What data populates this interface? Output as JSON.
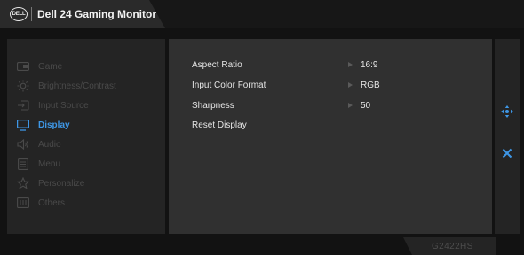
{
  "header": {
    "logo_text": "DELL",
    "title": "Dell 24 Gaming Monitor"
  },
  "colors": {
    "accent": "#3e97e6",
    "inactive_text": "#4a4a4a",
    "content_bg": "#303030",
    "panel_bg": "#242424"
  },
  "sidebar": {
    "items": [
      {
        "label": "Game",
        "icon": "game-icon",
        "active": false
      },
      {
        "label": "Brightness/Contrast",
        "icon": "brightness-icon",
        "active": false
      },
      {
        "label": "Input Source",
        "icon": "input-source-icon",
        "active": false
      },
      {
        "label": "Display",
        "icon": "display-icon",
        "active": true
      },
      {
        "label": "Audio",
        "icon": "audio-icon",
        "active": false
      },
      {
        "label": "Menu",
        "icon": "menu-icon",
        "active": false
      },
      {
        "label": "Personalize",
        "icon": "star-icon",
        "active": false
      },
      {
        "label": "Others",
        "icon": "others-icon",
        "active": false
      }
    ]
  },
  "content": {
    "rows": [
      {
        "label": "Aspect Ratio",
        "value": "16:9"
      },
      {
        "label": "Input Color Format",
        "value": "RGB"
      },
      {
        "label": "Sharpness",
        "value": "50"
      },
      {
        "label": "Reset Display",
        "value": ""
      }
    ]
  },
  "rightbar": {
    "icons": [
      "navigate-icon",
      "close-icon"
    ]
  },
  "footer": {
    "model": "G2422HS"
  }
}
